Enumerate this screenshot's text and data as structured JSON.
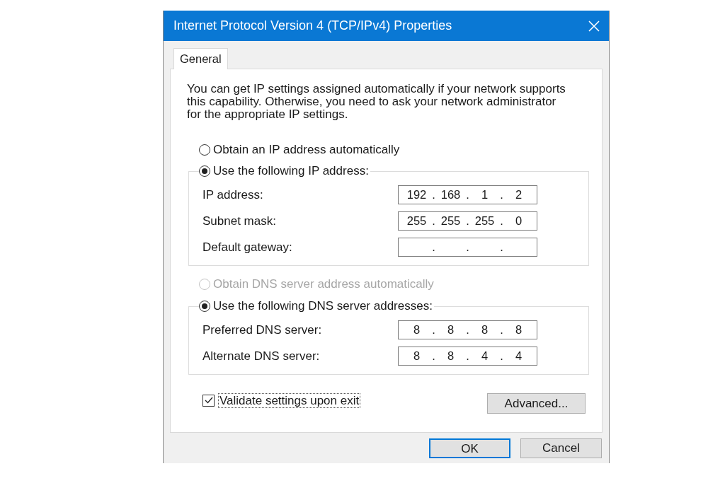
{
  "window": {
    "title": "Internet Protocol Version 4 (TCP/IPv4) Properties"
  },
  "tabs": [
    {
      "label": "General",
      "selected": true
    }
  ],
  "description": "You can get IP settings assigned automatically if your network supports this capability. Otherwise, you need to ask your network administrator for the appropriate IP settings.",
  "ip_settings": {
    "options": [
      {
        "label": "Obtain an IP address automatically",
        "selected": false,
        "disabled": false
      },
      {
        "label": "Use the following IP address:",
        "selected": true,
        "disabled": false
      }
    ],
    "fields": [
      {
        "label": "IP address:",
        "octets": [
          "192",
          "168",
          "1",
          "2"
        ],
        "separator": "."
      },
      {
        "label": "Subnet mask:",
        "octets": [
          "255",
          "255",
          "255",
          "0"
        ],
        "separator": "."
      },
      {
        "label": "Default gateway:",
        "separator": "."
      }
    ]
  },
  "dns_settings": {
    "options": [
      {
        "label": "Obtain DNS server address automatically",
        "selected": false,
        "disabled": true
      },
      {
        "label": "Use the following DNS server addresses:",
        "selected": true,
        "disabled": false
      }
    ],
    "fields": [
      {
        "label": "Preferred DNS server:",
        "octets": [
          "8",
          "8",
          "8",
          "8"
        ],
        "separator": "."
      },
      {
        "label": "Alternate DNS server:",
        "octets": [
          "8",
          "8",
          "4",
          "4"
        ],
        "separator": "."
      }
    ]
  },
  "validate_checkbox": {
    "label": "Validate settings upon exit",
    "checked": true,
    "focused": true
  },
  "advanced_button": {
    "label": "Advanced..."
  },
  "buttons": [
    {
      "label": "OK",
      "default": true
    },
    {
      "label": "Cancel",
      "default": false
    }
  ]
}
